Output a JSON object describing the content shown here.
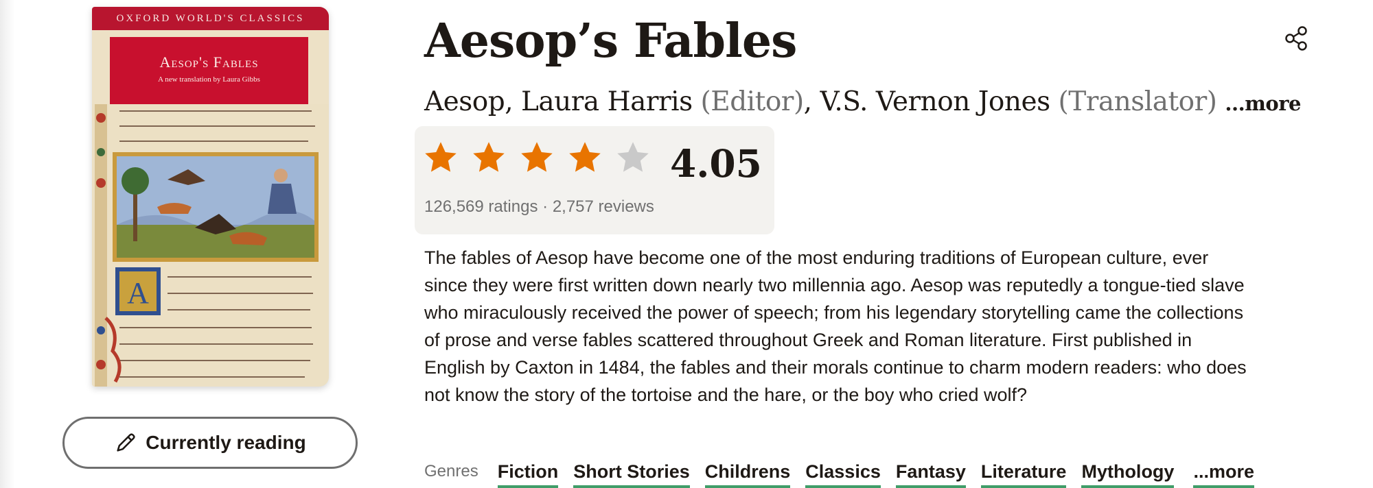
{
  "cover": {
    "series": "OXFORD WORLD'S CLASSICS",
    "title": "Aesop's Fables",
    "subtitle": "A new translation by Laura Gibbs",
    "accent_color": "#c8102e"
  },
  "reading_button": {
    "label": "Currently reading",
    "icon": "pencil-icon"
  },
  "book": {
    "title": "Aesop’s Fables"
  },
  "share": {
    "icon": "share-icon"
  },
  "authors": {
    "list": [
      {
        "name": "Aesop",
        "role": ""
      },
      {
        "name": "Laura Harris",
        "role": "(Editor)"
      },
      {
        "name": "V.S. Vernon Jones",
        "role": "(Translator)"
      }
    ],
    "more_label": "...more"
  },
  "rating": {
    "average": "4.05",
    "stars_filled": 4,
    "stars_total": 5,
    "star_color": "#e87400",
    "star_empty_color": "#c9c9c9",
    "ratings_text": "126,569 ratings",
    "separator": "·",
    "reviews_text": "2,757 reviews"
  },
  "description": {
    "text": "The fables of Aesop have become one of the most enduring traditions of European culture, ever since they were first written down nearly two millennia ago. Aesop was reputedly a tongue-tied slave who miraculously received the power of speech; from his legendary storytelling came the collections of prose and verse fables scattered throughout Greek and Roman literature. First published in English by Caxton in 1484, the fables and their morals continue to charm modern readers: who does not know the story of the tortoise and the hare, or the boy who cried wolf?"
  },
  "genres": {
    "label": "Genres",
    "items": [
      "Fiction",
      "Short Stories",
      "Childrens",
      "Classics",
      "Fantasy",
      "Literature",
      "Mythology"
    ],
    "more_label": "...more",
    "underline_color": "#409d69"
  }
}
